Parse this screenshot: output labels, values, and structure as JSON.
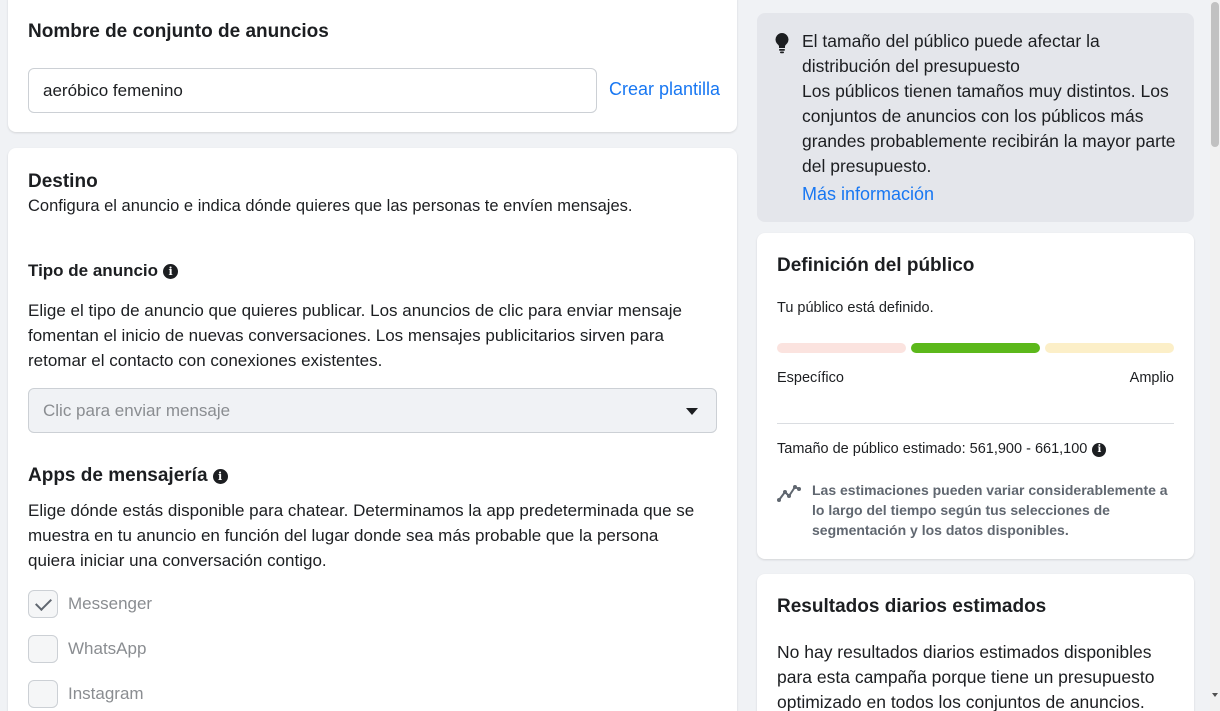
{
  "adset": {
    "title": "Nombre de conjunto de anuncios",
    "name_value": "aeróbico femenino",
    "create_template": "Crear plantilla"
  },
  "destination": {
    "title": "Destino",
    "subtitle": "Configura el anuncio e indica dónde quieres que las personas te envíen mensajes.",
    "ad_type": {
      "label": "Tipo de anuncio",
      "description_lines": [
        "Elige el tipo de anuncio que quieres publicar. Los anuncios de clic para enviar mensaje",
        "fomentan el inicio de nuevas conversaciones. Los mensajes publicitarios sirven para",
        "retomar el contacto con conexiones existentes."
      ],
      "selected": "Clic para enviar mensaje"
    },
    "messaging_apps": {
      "label": "Apps de mensajería",
      "description_lines": [
        "Elige dónde estás disponible para chatear. Determinamos la app predeterminada que se",
        "muestra en tu anuncio en función del lugar donde sea más probable que la persona",
        "quiera iniciar una conversación contigo."
      ],
      "options": [
        {
          "label": "Messenger",
          "checked": true
        },
        {
          "label": "WhatsApp",
          "checked": false
        },
        {
          "label": "Instagram",
          "checked": false
        }
      ]
    }
  },
  "tip": {
    "lines": [
      "El tamaño del público puede afectar la",
      "distribución del presupuesto",
      "Los públicos tienen tamaños muy distintos. Los",
      "conjuntos de anuncios con los públicos más",
      "grandes probablemente recibirán la mayor parte",
      "del presupuesto."
    ],
    "link": "Más información"
  },
  "audience": {
    "title": "Definición del público",
    "status": "Tu público está definido.",
    "meter_level": "middle",
    "specific_label": "Específico",
    "broad_label": "Amplio",
    "size_label": "Tamaño de público estimado: 561,900 - 661,100",
    "note_lines": [
      "Las estimaciones pueden variar considerablemente a",
      "lo largo del tiempo según tus selecciones de",
      "segmentación y los datos disponibles."
    ],
    "colors": {
      "specific": "#fbe3df",
      "defined": "#5cb81b",
      "broad": "#fcefc8"
    }
  },
  "daily_results": {
    "title": "Resultados diarios estimados",
    "lines": [
      "No hay resultados diarios estimados disponibles",
      "para esta campaña porque tiene un presupuesto",
      "optimizado en todos los conjuntos de anuncios."
    ]
  }
}
